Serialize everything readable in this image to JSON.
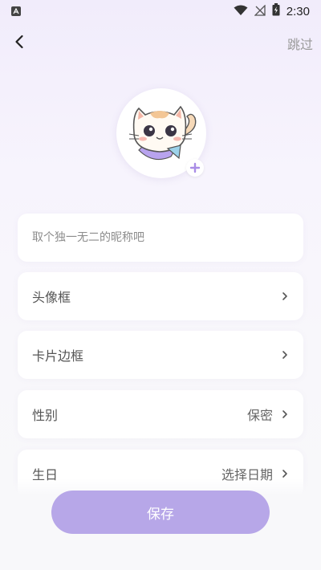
{
  "status_bar": {
    "time": "2:30"
  },
  "nav": {
    "skip_label": "跳过"
  },
  "nickname": {
    "placeholder": "取个独一无二的昵称吧"
  },
  "items": [
    {
      "label": "头像框",
      "value": ""
    },
    {
      "label": "卡片边框",
      "value": ""
    },
    {
      "label": "性别",
      "value": "保密"
    },
    {
      "label": "生日",
      "value": "选择日期"
    }
  ],
  "save_label": "保存",
  "colors": {
    "accent": "#b7a7e8",
    "plus": "#a98de6"
  }
}
